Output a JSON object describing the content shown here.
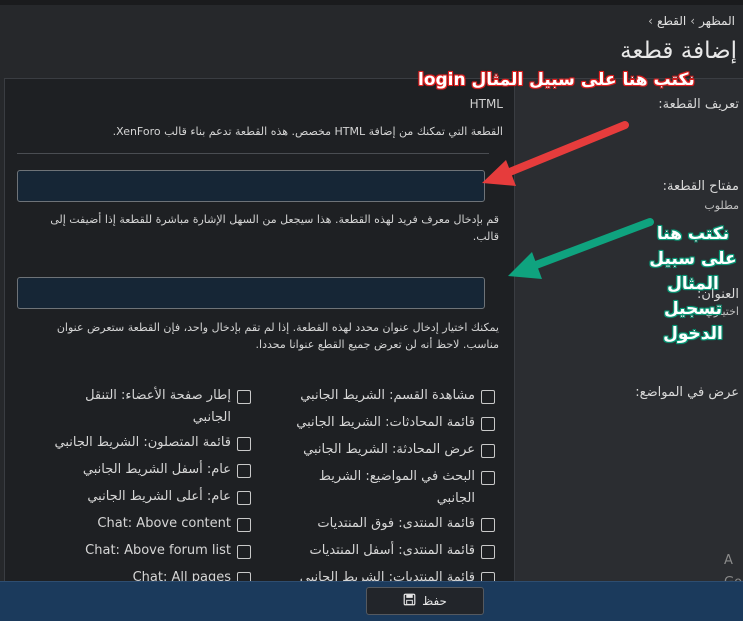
{
  "breadcrumb": [
    "المظهر",
    "القطع"
  ],
  "breadcrumb_sep": "›",
  "page_title": "إضافة قطعة",
  "fields": {
    "definition": {
      "label": "تعريف القطعة:",
      "value": "HTML",
      "description": "القطعة التي تمكنك من إضافة HTML مخصص. هذه القطعة تدعم بناء قالب XenForo."
    },
    "key": {
      "label": "مفتاح القطعة:",
      "hint": "مطلوب",
      "value": "",
      "description": "قم بإدخال معرف فريد لهذه القطعة. هذا سيجعل من السهل الإشارة مباشرة للقطعة إذا أضيفت إلى قالب."
    },
    "title": {
      "label": "العنوان:",
      "hint": "اختياري",
      "value": "",
      "description": "يمكنك اختيار إدخال عنوان محدد لهذه القطعة. إذا لم تقم بإدخال واحد، فإن القطعة ستعرض عنوان مناسب. لاحظ أنه لن تعرض جميع القطع عنوانا محددا."
    },
    "positions": {
      "label": "عرض في المواضع:",
      "col1": [
        "مشاهدة القسم: الشريط الجانبي",
        "قائمة المحادثات: الشريط الجانبي",
        "عرض المحادثة: الشريط الجانبي",
        "البحث في المواضيع: الشريط الجانبي",
        "قائمة المنتدى: فوق المنتديات",
        "قائمة المنتدى: أسفل المنتديات",
        "قائمة المنتديات: الشريط الجانبي"
      ],
      "col2": [
        "إطار صفحة الأعضاء: التنقل الجانبي",
        "قائمة المتصلون: الشريط الجانبي",
        "عام: أسفل الشريط الجانبي",
        "عام: أعلى الشريط الجانبي",
        "Chat: Above content",
        "Chat: Above forum list",
        "Chat: All pages"
      ]
    }
  },
  "save_label": "حفظ",
  "side_ghost": [
    "A",
    "Go"
  ],
  "annotations": {
    "red": "نكتب هنا على سبيل المثال login",
    "green": "نكتب هنا على سبيل المثال تسجيل الدخول"
  },
  "colors": {
    "red_arrow": "#e63c3c",
    "green_arrow": "#0fa37f",
    "footer": "#1b3a5c"
  }
}
